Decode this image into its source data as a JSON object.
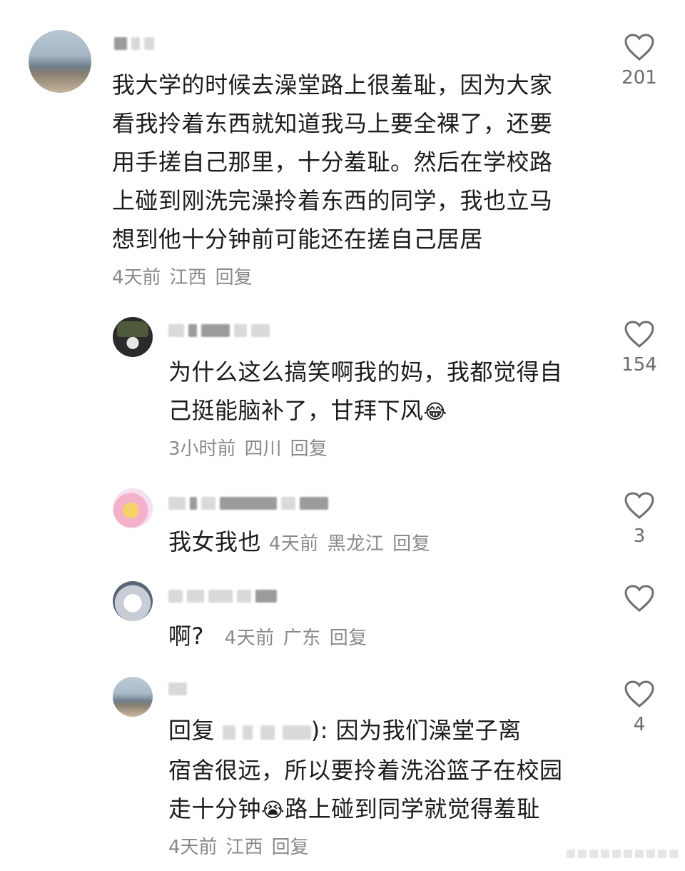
{
  "comments": [
    {
      "text_lines": [
        "我大学的时候去澡堂路上很羞耻，因为大家",
        "看我拎着东西就知道我马上要全裸了，还要",
        "用手搓自己那里，十分羞耻。然后在学校路",
        "上碰到刚洗完澡拎着东西的同学，我也立马",
        "想到他十分钟前可能还在搓自己居居"
      ],
      "time": "4天前",
      "location": "江西",
      "reply_label": "回复",
      "likes": "201"
    },
    {
      "text_lines": [
        "为什么这么搞笑啊我的妈，我都觉得自",
        "己挺能脑补了，甘拜下风"
      ],
      "emoji": "😂",
      "time": "3小时前",
      "location": "四川",
      "reply_label": "回复",
      "likes": "154"
    },
    {
      "text": "我女我也",
      "time": "4天前",
      "location": "黑龙江",
      "reply_label": "回复",
      "likes": "3"
    },
    {
      "text": "啊?",
      "time": "4天前",
      "location": "广东",
      "reply_label": "回复",
      "likes": ""
    },
    {
      "reply_prefix": "回复",
      "mention_tail": "):",
      "text_lines": [
        "因为我们澡堂子离",
        "宿舍很远，所以要拎着洗浴篮子在校园",
        "走十分钟",
        "路上碰到同学就觉得羞耻"
      ],
      "emoji": "😭",
      "time": "4天前",
      "location": "江西",
      "reply_label": "回复",
      "likes": "4"
    }
  ]
}
